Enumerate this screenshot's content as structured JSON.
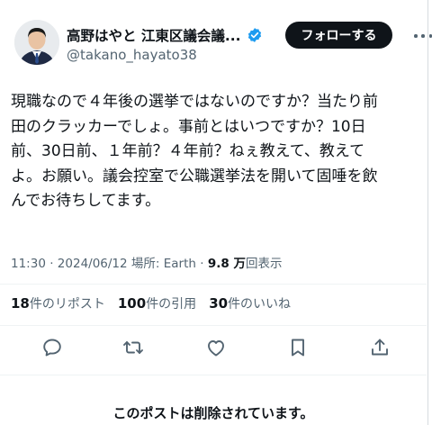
{
  "author": {
    "name": "高野はやと 江東区議会議...",
    "handle": "@takano_hayato38",
    "verified": true
  },
  "follow_button": "フォローする",
  "tweet": {
    "text": "現職なので４年後の選挙ではないのですか？当たり前\n田のクラッカーでしょ。事前とはいつですか？10日\n前、30日前、１年前？４年前？ねぇ教えて、教えて\nよ。お願い。議会控室で公職選挙法を開いて固唾を飲\nんでお待ちしてます。"
  },
  "meta": {
    "time": "11:30",
    "date": "2024/06/12",
    "location_label": "場所: Earth",
    "views_count": "9.8 万",
    "views_label": "回表示"
  },
  "stats": {
    "reposts_count": "18",
    "reposts_label": "件のリポスト",
    "quotes_count": "100",
    "quotes_label": "件の引用",
    "likes_count": "30",
    "likes_label": "件のいいね"
  },
  "actions": [
    "reply-icon",
    "repost-icon",
    "like-icon",
    "bookmark-icon",
    "share-icon"
  ],
  "deleted_notice": "このポストは削除されています。",
  "colors": {
    "text": "#0f1419",
    "secondary": "#536471",
    "verified": "#1d9bf0",
    "follow_bg": "#0f1419"
  }
}
